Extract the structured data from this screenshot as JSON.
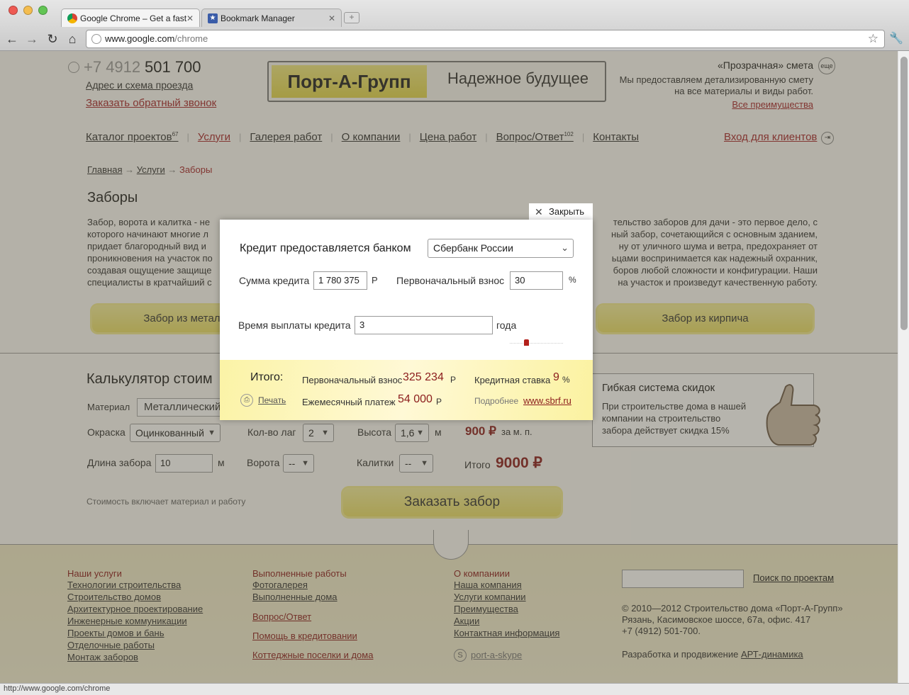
{
  "browser": {
    "tabs": [
      {
        "title": "Google Chrome – Get a fast",
        "close": "✕"
      },
      {
        "title": "Bookmark Manager",
        "close": "✕"
      }
    ],
    "url_domain": "www.google.com",
    "url_path": "/chrome",
    "status_url": "http://www.google.com/chrome"
  },
  "header": {
    "phone_prefix": "+7 4912",
    "phone_number": "501 700",
    "address_link": "Адрес и схема проезда",
    "callback_link": "Заказать обратный звонок",
    "logo": "Порт-А-Групп",
    "slogan": "Надежное будущее",
    "estimate_title": "«Прозрачная» смета",
    "estimate_badge": "еще",
    "estimate_text_1": "Мы предоставляем детализированную смету",
    "estimate_text_2": "на все материалы и виды работ.",
    "advantages_link": "Все преимущества"
  },
  "menu": {
    "items": [
      {
        "label": "Каталог проектов",
        "sup": "67"
      },
      {
        "label": "Услуги",
        "sup": ""
      },
      {
        "label": "Галерея работ",
        "sup": ""
      },
      {
        "label": "О компании",
        "sup": ""
      },
      {
        "label": "Цена работ",
        "sup": ""
      },
      {
        "label": "Вопрос/Ответ",
        "sup": "102"
      },
      {
        "label": "Контакты",
        "sup": ""
      }
    ],
    "login": "Вход для клиентов"
  },
  "breadcrumb": {
    "home": "Главная",
    "services": "Услуги",
    "current": "Заборы",
    "arrow": "→"
  },
  "content": {
    "title": "Заборы",
    "left_lines": [
      "Забор, ворота и калитка - не",
      "которого начинают многие л",
      "придает благородный вид и",
      "проникновения на участок по",
      "создавая ощущение защище",
      "специалисты в кратчайший с"
    ],
    "right_lines": [
      "тельство заборов для дачи - это первое дело, с",
      "ный забор, сочетающийся с основным зданием,",
      "ну от уличного шума и ветра, предохраняет от",
      "ьцами воспринимается как надежный охранник,",
      "боров любой сложности и конфигурации. Наши",
      "на участок и произведут качественную работу."
    ],
    "btn_metal": "Забор из металическо",
    "btn_brick": "Забор из кирпича"
  },
  "calculator": {
    "title": "Калькулятор стоим",
    "material_label": "Материал",
    "material_value": "Металлический",
    "paint_label": "Окраска",
    "paint_value": "Оцинкованный",
    "lag_label": "Кол-во лаг",
    "lag_value": "2",
    "height_label": "Высота",
    "height_value": "1,6",
    "unit_m": "м",
    "price_per_m": "900 ₽",
    "price_per_m_suffix": "за м. п.",
    "length_label": "Длина забора",
    "length_value": "10",
    "gate_label": "Ворота",
    "gate_value": "--",
    "wicket_label": "Калитки",
    "wicket_value": "--",
    "total_label": "Итого",
    "total_value": "9000 ₽",
    "note": "Стоимость включает материал и работу",
    "order_button": "Заказать забор"
  },
  "discount": {
    "title": "Гибкая система скидок",
    "text_1": "При строительстве дома в нашей",
    "text_2": "компании на строительство",
    "text_3": "забора действует скидка 15%"
  },
  "footer": {
    "col1_title": "Наши услуги",
    "col1": [
      "Технологии строительства",
      "Строительство домов",
      "Архитектурное проектирование",
      "Инженерные коммуникации",
      "Проекты домов и бань",
      "Отделочные работы",
      "Монтаж заборов"
    ],
    "col2_title": "Выполненные работы",
    "col2": [
      "Фотогалерея",
      "Выполненные дома"
    ],
    "col2_links": [
      "Вопрос/Ответ",
      "Помощь в кредитовании",
      "Коттеджные поселки и дома"
    ],
    "col3_title": "О компаниии",
    "col3": [
      "Наша компания",
      "Услуги компании",
      "Преимущества",
      "Акции",
      "Контактная информация"
    ],
    "skype": "port-a-skype",
    "search_button": "Поиск по проектам",
    "copyright": "© 2010—2012 Строительство дома «Порт-А-Групп»",
    "address": "Рязань, Касимовское шоссе, 67а, офис. 417",
    "phone": "+7 (4912) 501-700.",
    "dev_prefix": "Разработка и продвижение",
    "dev_link": "АРТ-динамика"
  },
  "modal": {
    "close": "Закрыть",
    "bank_label": "Кредит предоставляется банком",
    "bank_value": "Сбербанк России",
    "sum_label": "Сумма кредита",
    "sum_value": "1 780 375",
    "currency": "Р",
    "down_label": "Первоначальный взнос",
    "down_value": "30",
    "percent": "%",
    "time_label": "Время выплаты кредита",
    "time_value": "3",
    "time_unit": "года",
    "down_slider_percent": 30,
    "time_slider_percent": 3,
    "total_label": "Итого:",
    "down_result_label": "Первоначальный взнос",
    "down_result_value": "325 234",
    "rate_label": "Кредитная ставка",
    "rate_value": "9",
    "monthly_label": "Ежемесячный платеж",
    "monthly_value": "54 000",
    "print": "Печать",
    "more_label": "Подробнее",
    "more_link": "www.sbrf.ru"
  }
}
